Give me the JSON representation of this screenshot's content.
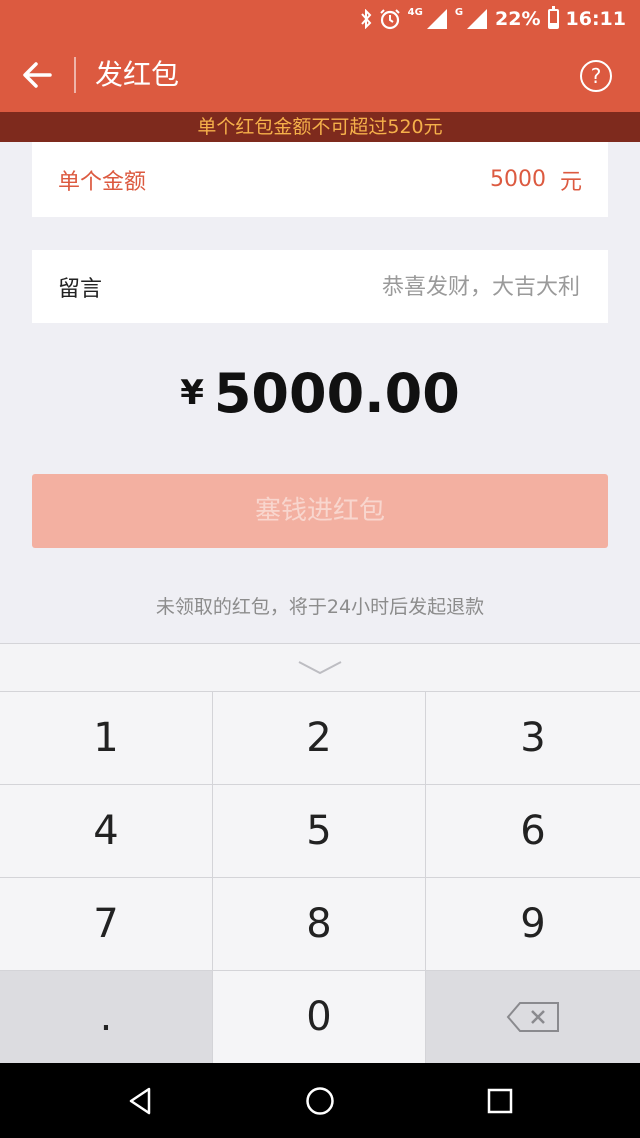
{
  "status": {
    "net_label": "4G",
    "net2_label": "G",
    "battery": "22%",
    "time": "16:11"
  },
  "appbar": {
    "title": "发红包",
    "help": "?"
  },
  "warning": "单个红包金额不可超过520元",
  "amount_field": {
    "label": "单个金额",
    "value": "5000",
    "unit": "元"
  },
  "message_field": {
    "label": "留言",
    "placeholder": "恭喜发财，大吉大利"
  },
  "total": {
    "currency": "¥",
    "amount": "5000.00"
  },
  "submit_label": "塞钱进红包",
  "refund_note": "未领取的红包，将于24小时后发起退款",
  "keypad": {
    "keys": [
      "1",
      "2",
      "3",
      "4",
      "5",
      "6",
      "7",
      "8",
      "9",
      ".",
      "0"
    ]
  },
  "colors": {
    "brand": "#dc5a40",
    "warning_bg": "#7e2a1d",
    "warning_text": "#f5b04a",
    "button_disabled": "#f3b0a1"
  }
}
